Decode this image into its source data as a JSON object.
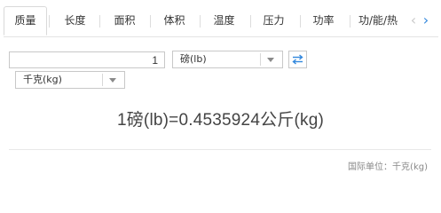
{
  "tabs": [
    {
      "label": "质量",
      "active": true
    },
    {
      "label": "长度",
      "active": false
    },
    {
      "label": "面积",
      "active": false
    },
    {
      "label": "体积",
      "active": false
    },
    {
      "label": "温度",
      "active": false
    },
    {
      "label": "压力",
      "active": false
    },
    {
      "label": "功率",
      "active": false
    },
    {
      "label": "功/能/热",
      "active": false
    }
  ],
  "nav": {
    "prev": "‹",
    "next": "›"
  },
  "converter": {
    "input_value": "1",
    "from_unit": "磅(lb)",
    "to_unit": "千克(kg)",
    "swap_icon": "swap-icon"
  },
  "result": {
    "text": "1磅(lb)=0.4535924公斤(kg)"
  },
  "footer": {
    "si_note": "国际单位：千克(kg)"
  },
  "colors": {
    "accent": "#3388dd",
    "border": "#c8c8c8",
    "text": "#333333",
    "muted": "#888888"
  }
}
